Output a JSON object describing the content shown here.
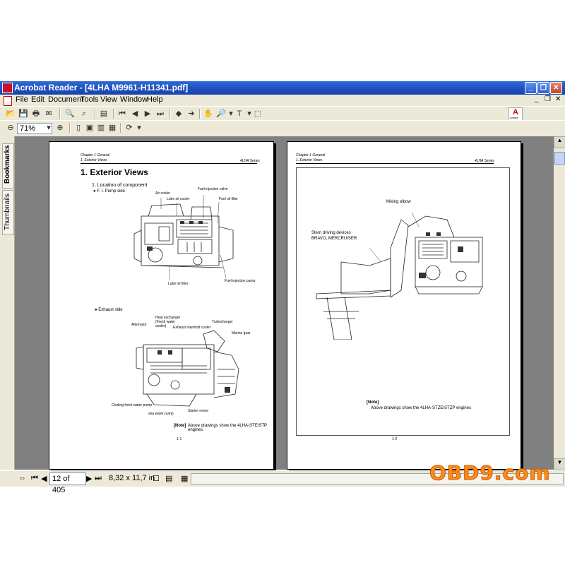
{
  "window": {
    "title": "Acrobat Reader - [4LHA   M9961-H11341.pdf]"
  },
  "menu": [
    "File",
    "Edit",
    "Document",
    "Tools",
    "View",
    "Window",
    "Help"
  ],
  "toolbar": {
    "zoom_value": "71%",
    "brand": "Adobe"
  },
  "sidebar": {
    "tabs": [
      "Bookmarks",
      "Thumbnails"
    ]
  },
  "left_page": {
    "header_line1": "Chapter 1 General",
    "header_line2": "1. Exterior Views",
    "series": "4LHA Series",
    "title": "1. Exterior Views",
    "section": "1.  Location of component",
    "bullet1": "● F. I. Pump side",
    "bullet2": "● Exhaust side",
    "labels_top": [
      "Fuel injection valve",
      "Air cooler",
      "Lube oil cooler",
      "Fuel oil filter",
      "Lube oil filter",
      "Fuel injection pump"
    ],
    "labels_bottom": [
      "Heat exchanger (Fresh water cooler)",
      "Alternator",
      "Turbocharger",
      "Exhaust manifold cooler",
      "Marine gear",
      "Cooling fresh water pump",
      "sea water pump",
      "Starter motor"
    ],
    "note_label": "[Note]",
    "note_text": "Above drawings show the 4LHA-STE/STP engines.",
    "page_number": "1-1"
  },
  "right_page": {
    "header_line1": "Chapter 1 General",
    "header_line2": "1. Exterior Views",
    "series": "4LHA Series",
    "label_mixing": "Mixing elbow",
    "label_stern1": "Stern driving devices",
    "label_stern2": "BRAVO, MERCRUISER",
    "note_label": "[Note]",
    "note_text": "Above drawings show the 4LHA-STZE/STZP engines",
    "page_number": "1-2"
  },
  "status": {
    "page_field": "12 of 405",
    "page_size": "8,32 x 11,7 in"
  },
  "watermark": "OBD9.com"
}
